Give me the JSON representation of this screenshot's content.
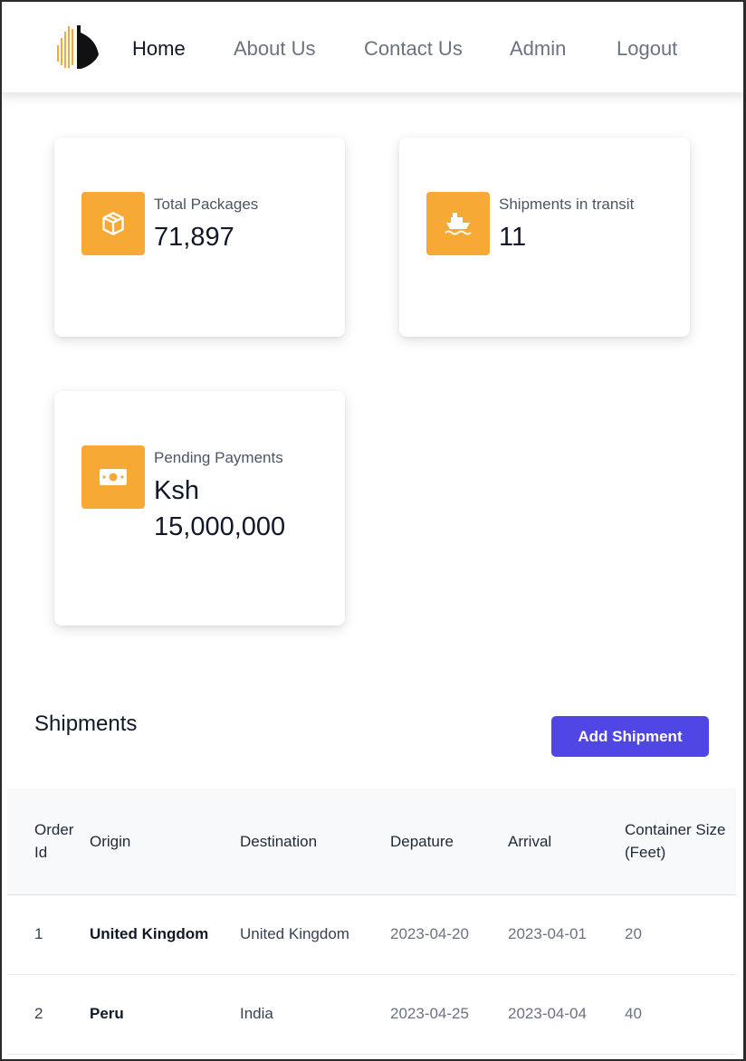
{
  "nav": {
    "items": [
      {
        "label": "Home",
        "active": true
      },
      {
        "label": "About Us",
        "active": false
      },
      {
        "label": "Contact Us",
        "active": false
      },
      {
        "label": "Admin",
        "active": false
      },
      {
        "label": "Logout",
        "active": false
      }
    ]
  },
  "stats": [
    {
      "label": "Total Packages",
      "value": "71,897",
      "icon": "package-icon"
    },
    {
      "label": "Shipments in transit",
      "value": "11",
      "icon": "ship-icon"
    },
    {
      "label": "Pending Payments",
      "value": "Ksh 15,000,000",
      "icon": "money-icon"
    }
  ],
  "shipments": {
    "title": "Shipments",
    "add_button": "Add Shipment",
    "columns": [
      "Order Id",
      "Origin",
      "Destination",
      "Depature",
      "Arrival",
      "Container Size (Feet)"
    ],
    "rows": [
      [
        "1",
        "United Kingdom",
        "United Kingdom",
        "2023-04-20",
        "2023-04-01",
        "20"
      ],
      [
        "2",
        "Peru",
        "India",
        "2023-04-25",
        "2023-04-04",
        "40"
      ]
    ]
  },
  "colors": {
    "accent": "#f6a934",
    "primary_button": "#4f46e5",
    "text_dark": "#111827",
    "text_muted": "#6b7280"
  }
}
